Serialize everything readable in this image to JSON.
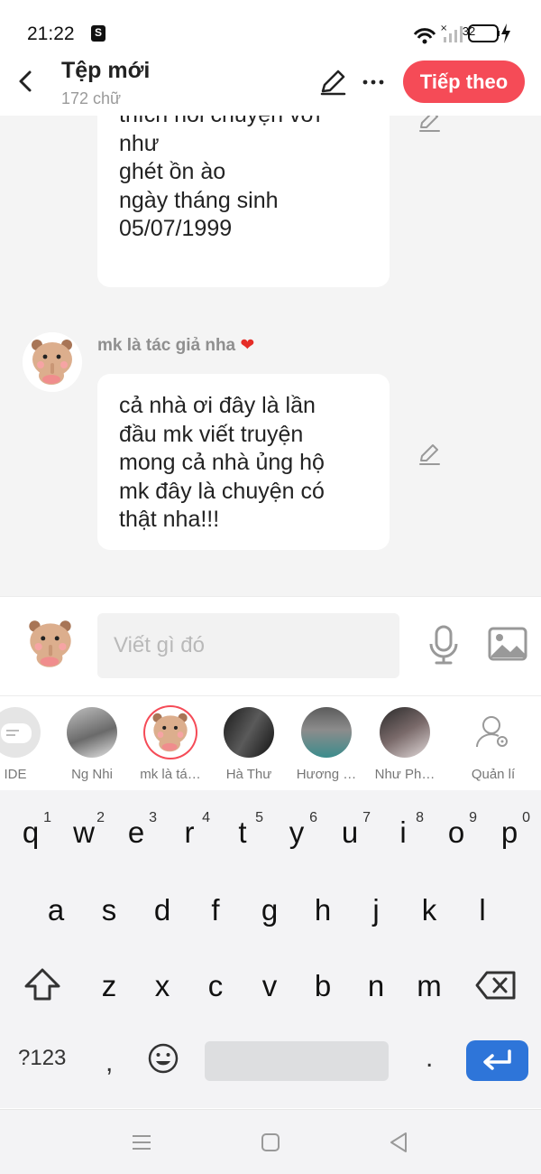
{
  "status_bar": {
    "time": "21:22",
    "battery": "32"
  },
  "header": {
    "title": "Tệp mới",
    "subtitle": "172 chữ",
    "next_label": "Tiếp theo"
  },
  "messages": [
    {
      "lines": [
        "thích nói chuyện với",
        "như",
        "ghét ồn ào",
        "ngày tháng sinh",
        "05/07/1999"
      ]
    },
    {
      "author": "mk là tác giả nha",
      "lines": [
        "cả nhà ơi đây là lần",
        "đầu mk viết truyện",
        "mong cả nhà ủng hộ",
        "mk đây là chuyện có",
        "thật nha!!!"
      ]
    }
  ],
  "composer": {
    "placeholder": "Viết gì đó"
  },
  "personas": [
    {
      "label": "IDE"
    },
    {
      "label": "Ng Nhi"
    },
    {
      "label": "mk là tá…"
    },
    {
      "label": "Hà Thư"
    },
    {
      "label": "Hương …"
    },
    {
      "label": "Như Ph…"
    },
    {
      "label": "Quản lí"
    }
  ],
  "keyboard": {
    "row1": [
      {
        "k": "q",
        "n": "1"
      },
      {
        "k": "w",
        "n": "2"
      },
      {
        "k": "e",
        "n": "3"
      },
      {
        "k": "r",
        "n": "4"
      },
      {
        "k": "t",
        "n": "5"
      },
      {
        "k": "y",
        "n": "6"
      },
      {
        "k": "u",
        "n": "7"
      },
      {
        "k": "i",
        "n": "8"
      },
      {
        "k": "o",
        "n": "9"
      },
      {
        "k": "p",
        "n": "0"
      }
    ],
    "row2": [
      "a",
      "s",
      "d",
      "f",
      "g",
      "h",
      "j",
      "k",
      "l"
    ],
    "row3": [
      "z",
      "x",
      "c",
      "v",
      "b",
      "n",
      "m"
    ],
    "symbols_label": "?123",
    "comma_label": ",",
    "period_label": "."
  },
  "colors": {
    "accent": "#f54b57",
    "enter": "#2e75d9"
  }
}
